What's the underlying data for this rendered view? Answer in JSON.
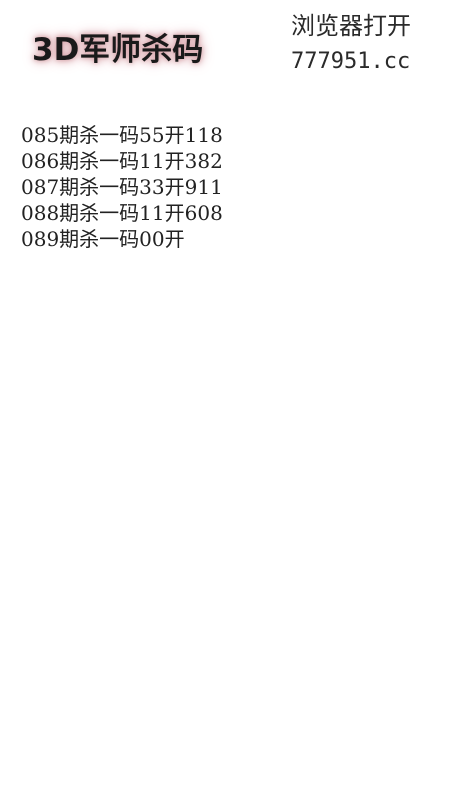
{
  "header": {
    "logo_text": "3D军师杀码",
    "browser_hint": "浏览器打开",
    "site_url": "777951.cc"
  },
  "records": [
    {
      "text": "085期杀一码55开118"
    },
    {
      "text": "086期杀一码11开382"
    },
    {
      "text": "087期杀一码33开911"
    },
    {
      "text": "088期杀一码11开608"
    },
    {
      "text": "089期杀一码00开"
    }
  ],
  "colors": {
    "text": "#222222",
    "logo_glow": "#d9a7ad",
    "background": "#ffffff"
  }
}
